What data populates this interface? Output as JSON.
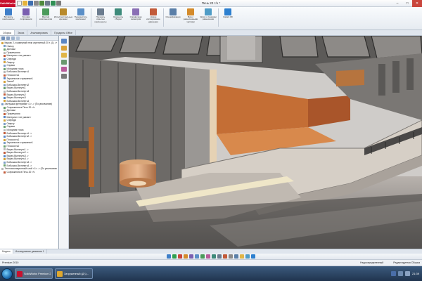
{
  "app": {
    "brand": "SolidWorks",
    "window_title": "Печь 20 т/ч *"
  },
  "window_controls": {
    "minimize": "–",
    "maximize": "□",
    "close": "✕"
  },
  "ribbon": {
    "buttons": [
      {
        "label": "Вставить компоненты",
        "icon": "insert-component-icon",
        "color": "#3f7fc9"
      },
      {
        "label": "Условия сопряжения",
        "icon": "mate-icon",
        "color": "#7a5fb0"
      },
      {
        "label": "Массив компонентов",
        "icon": "pattern-icon",
        "color": "#4a9a5a"
      },
      {
        "label": "Интеллектуальные крепежи",
        "icon": "smart-fastener-icon",
        "color": "#b88a2c"
      },
      {
        "label": "Переместить компонент",
        "icon": "move-component-icon",
        "color": "#5b8fc7"
      },
      {
        "label": "Показать скрытые компоненты",
        "icon": "show-hidden-icon",
        "color": "#6b7c8f"
      },
      {
        "label": "Элементы сборки",
        "icon": "assembly-feature-icon",
        "color": "#3d8a7a"
      },
      {
        "label": "Справочная геометрия",
        "icon": "ref-geometry-icon",
        "color": "#8a6fb5"
      },
      {
        "label": "Новое исследование движения",
        "icon": "motion-study-icon",
        "color": "#c25b3a"
      },
      {
        "label": "Спецификация",
        "icon": "bom-icon",
        "color": "#5a7fa8"
      },
      {
        "label": "Вид с разнесенными частями",
        "icon": "exploded-view-icon",
        "color": "#d48b2c"
      },
      {
        "label": "Эскиз с линиями разнесения",
        "icon": "explode-line-icon",
        "color": "#4f9cc6"
      },
      {
        "label": "Instant 3D",
        "icon": "instant3d-icon",
        "color": "#2c7fcf"
      }
    ]
  },
  "command_tabs": [
    "Сборка",
    "Эскиз",
    "Анализировать",
    "Продукты Office"
  ],
  "feature_tree": {
    "items": [
      "Каркас 2-х камерной печи агрегатный 20 т. (1) -тч",
      "History",
      "Датчики",
      "Примечания",
      "Материал <не указан>",
      "Спереди",
      "Сверху",
      "Справа",
      "Исходная точка",
      "Бобышка-Вытянуть1",
      "Плоскость1",
      "Зеркальное отражение1",
      "Эскиз7",
      "Бобышка-Вытянуть2",
      "Вырез-Вытянуть1",
      "Бобышка-Вытянуть3",
      "Вырез-Вытянуть2",
      "Вырез-Вытянуть3",
      "Бобышка-Вытянуть4",
      "Заглушка футеровки <1> -> (По умолчанию)",
      "Сопряжения в Печь 20 т/ч",
      "Датчики",
      "Примечания",
      "Материал <не указан>",
      "Спереди",
      "Сверху",
      "Справа",
      "Исходная точка",
      "Бобышка-Вытянуть1 ->",
      "Бобышка-Вытянуть2 ->",
      "Плоскость1",
      "Зеркальное отражение1",
      "Плоскость2",
      "Вырез-Вытянуть1 ->",
      "Вырез-Вытянуть2 ->",
      "Вырез-Вытянуть3 ->",
      "Вырез-Вытянуть4 ->",
      "Бобышка-Вытянуть3 ->",
      "Бобышка-Вытянуть4 ->",
      "Теплоизоляционный слой <1> -> (По умолчанию)",
      "Сопряжения в Печь 20 т/ч"
    ]
  },
  "panel_tabs": [
    "Модель",
    "Исследование движения 1"
  ],
  "status": {
    "left": "Premium 2010",
    "state": "Недоопределенный",
    "mode": "Редактируется Сборка"
  },
  "taskbar": {
    "apps": [
      {
        "label": "SolidWorks Premium 2...",
        "active": true,
        "color": "#c8102e"
      },
      {
        "label": "Загруженный (Д:\\)...",
        "active": false,
        "color": "#e0a82e"
      }
    ],
    "clock": "21:39"
  }
}
